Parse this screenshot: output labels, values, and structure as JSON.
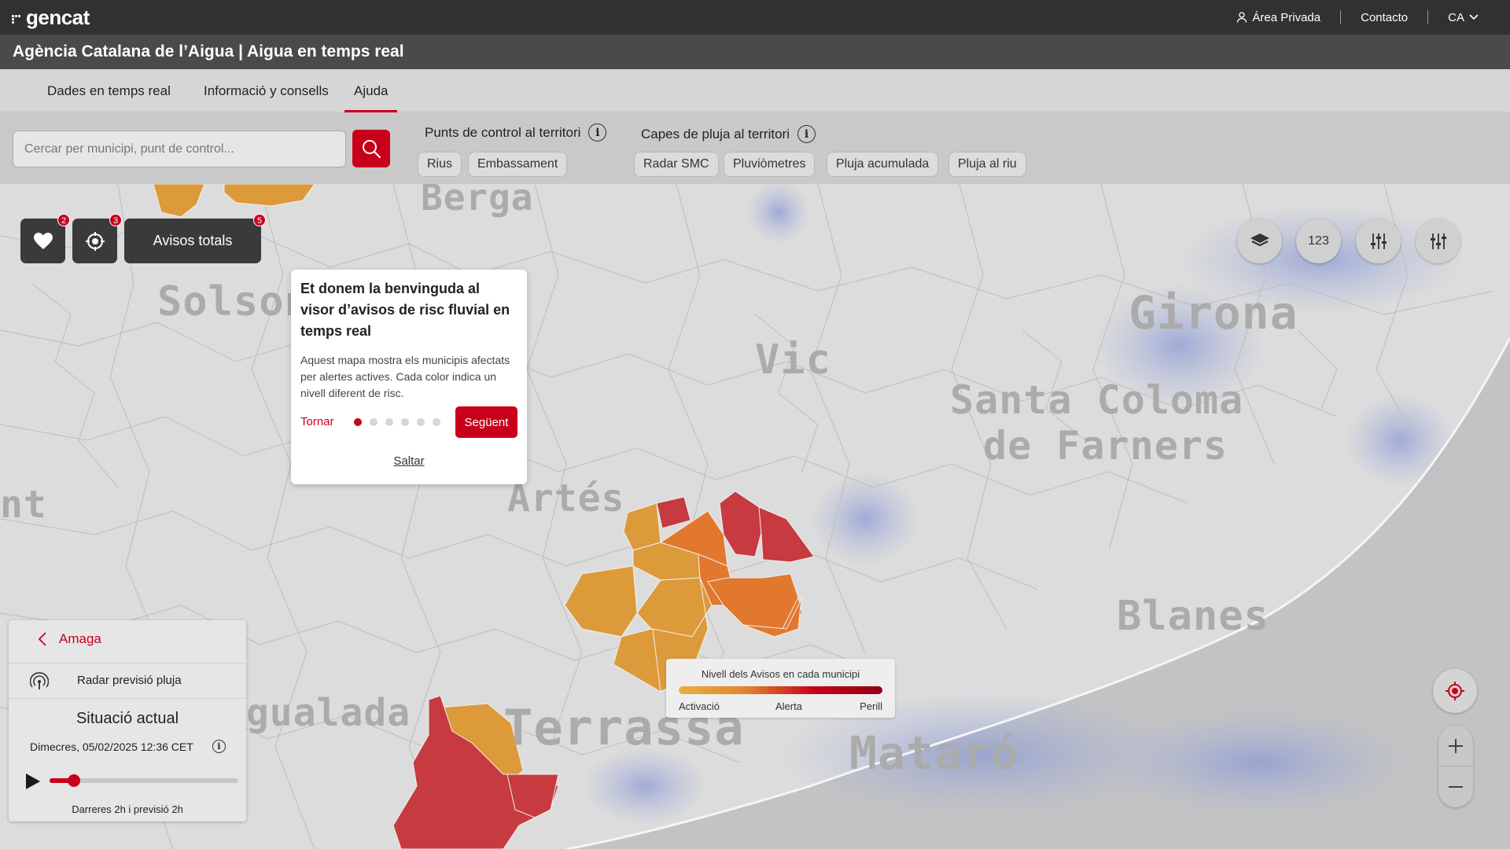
{
  "brand": {
    "logo_text": "gencat"
  },
  "top_nav": {
    "private_area": "Área Privada",
    "contact": "Contacto",
    "language": "CA"
  },
  "app": {
    "title": "Agència Catalana de l’Aigua | Aigua en temps real"
  },
  "tabs": [
    {
      "label": "Dades en temps real",
      "active": false
    },
    {
      "label": "Informació y consells",
      "active": false
    },
    {
      "label": "Ajuda",
      "active": true
    }
  ],
  "search": {
    "placeholder": "Cercar per municipi, punt de control..."
  },
  "filters": {
    "control_points": {
      "title": "Punts de control al territori",
      "chips": [
        "Rius",
        "Embassament"
      ]
    },
    "rain_layers": {
      "title": "Capes de pluja al territori",
      "chips": [
        "Radar SMC",
        "Pluviòmetres",
        "Pluja acumulada",
        "Pluja al riu"
      ]
    }
  },
  "map": {
    "cities": [
      "Berga",
      "Solsona",
      "Girona",
      "Vic",
      "Santa Coloma",
      "de Farners",
      "Artés",
      "Blanes",
      "Igualada",
      "Terrassa",
      "Mataró",
      "nt"
    ],
    "favorites_count": "2",
    "locations_count": "3",
    "avisos_label": "Avisos totals",
    "avisos_count": "5",
    "numbers_toggle": "123"
  },
  "welcome_popup": {
    "title": "Et donem la benvinguda al visor d’avisos de risc fluvial en temps real",
    "body": "Aquest mapa mostra els municipis afectats per alertes actives. Cada color indica un nivell diferent de risc.",
    "back": "Tornar",
    "next": "Següent",
    "skip": "Saltar",
    "step_current": 1,
    "step_total": 6
  },
  "legend": {
    "title": "Nivell dels Avisos en cada municipi",
    "levels": [
      "Activació",
      "Alerta",
      "Perill"
    ],
    "colors": {
      "activacio": "#e7b23d",
      "alerta": "#e2822e",
      "perill": "#c8001a"
    }
  },
  "side_panel": {
    "hide": "Amaga",
    "radar_label": "Radar previsió pluja",
    "status_title": "Situació actual",
    "datetime": "Dimecres, 05/02/2025 12:36 CET",
    "range_text": "Darreres 2h i previsió 2h",
    "progress": 0.13
  },
  "colors": {
    "accent": "#c8001a",
    "dark": "#313131"
  }
}
